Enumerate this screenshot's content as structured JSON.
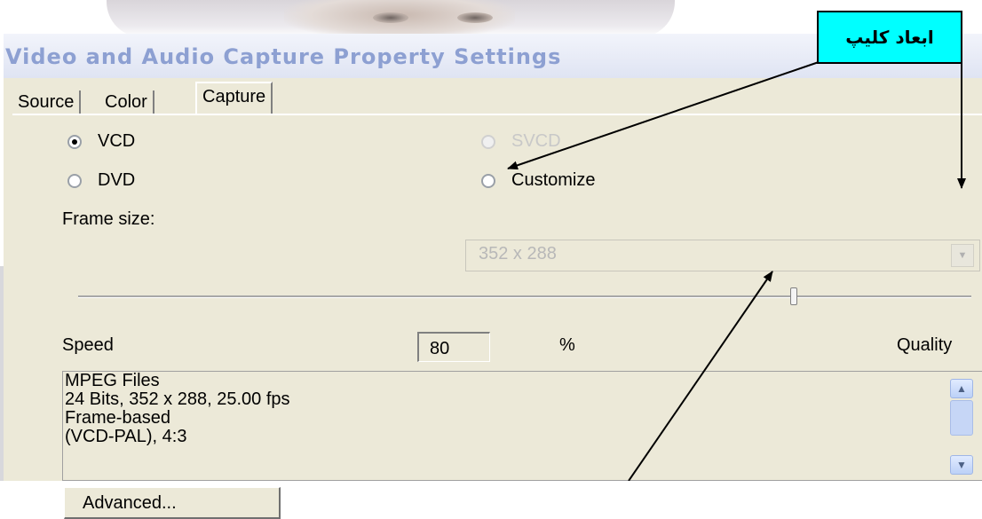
{
  "window": {
    "title": "Video and Audio Capture Property Settings"
  },
  "tabs": [
    {
      "label": "Source"
    },
    {
      "label": "Color"
    },
    {
      "label": "Capture"
    }
  ],
  "radios": {
    "vcd": {
      "label": "VCD",
      "checked": true
    },
    "svcd": {
      "label": "SVCD",
      "disabled": true
    },
    "dvd": {
      "label": "DVD",
      "checked": false
    },
    "customize": {
      "label": "Customize",
      "checked": false
    }
  },
  "frame_size": {
    "label": "Frame size:",
    "value": "352 x 288"
  },
  "quality": {
    "speed_label": "Speed",
    "quality_label": "Quality",
    "value": "80",
    "unit": "%"
  },
  "info": {
    "lines": [
      "MPEG Files",
      "24 Bits, 352 x 288, 25.00 fps",
      "Frame-based",
      "(VCD-PAL), 4:3"
    ]
  },
  "advanced_button": {
    "label": "Advanced..."
  },
  "annotation": {
    "callout_text": "ابعاد كليپ",
    "callout_color": "#00ffff"
  }
}
